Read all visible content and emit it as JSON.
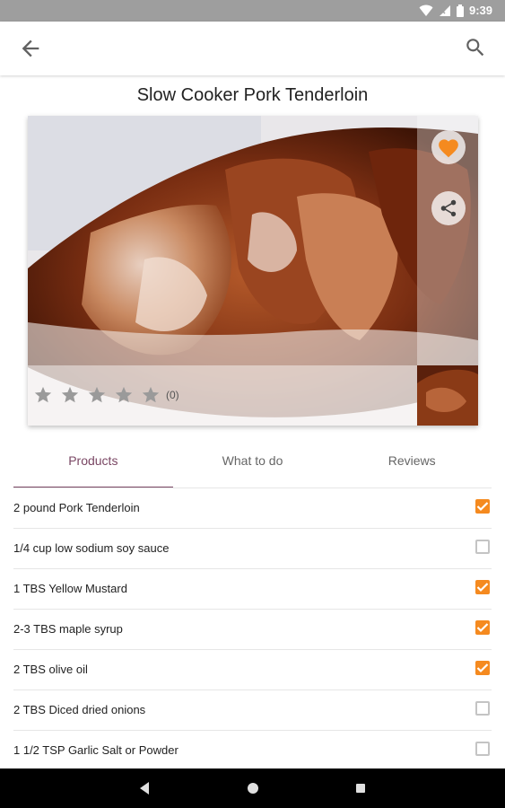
{
  "status_bar": {
    "time": "9:39"
  },
  "app_bar": {
    "back_icon": "arrow-back-icon",
    "search_icon": "search-icon"
  },
  "recipe": {
    "title": "Slow Cooker Pork Tenderloin",
    "rating": {
      "stars": 0,
      "max": 5,
      "count_label": "(0)"
    },
    "favorite_color": "#f58a1f"
  },
  "tabs": [
    {
      "label": "Products",
      "active": true
    },
    {
      "label": "What to do",
      "active": false
    },
    {
      "label": "Reviews",
      "active": false
    }
  ],
  "ingredients": [
    {
      "text": "2 pound Pork Tenderloin",
      "checked": true
    },
    {
      "text": "1/4 cup low sodium soy sauce",
      "checked": false
    },
    {
      "text": "1 TBS Yellow Mustard",
      "checked": true
    },
    {
      "text": "2-3 TBS maple syrup",
      "checked": true
    },
    {
      "text": "2 TBS olive oil",
      "checked": true
    },
    {
      "text": "2 TBS Diced dried onions",
      "checked": false
    },
    {
      "text": "1 1/2 TSP Garlic Salt or Powder",
      "checked": false
    }
  ],
  "colors": {
    "accent": "#f58a1f",
    "tab_active": "#7a4764"
  }
}
